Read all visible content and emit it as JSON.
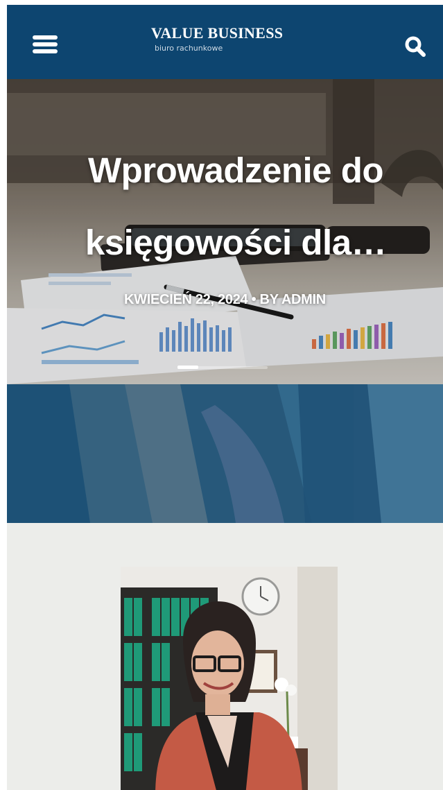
{
  "header": {
    "brand_title": "VALUE BUSINESS",
    "brand_subtitle": "biuro rachunkowe",
    "menu_icon": "hamburger-menu-icon",
    "search_icon": "search-icon",
    "background_color": "#0d4570"
  },
  "hero": {
    "title_line1": "Wprowadzenie do",
    "title_line2": "księgowości dla…",
    "meta": "KWIECIEŃ 22, 2024 • BY ADMIN",
    "slider_progress": 0.23
  },
  "colors": {
    "accent": "#0d4570",
    "section_background": "#ecedea"
  }
}
